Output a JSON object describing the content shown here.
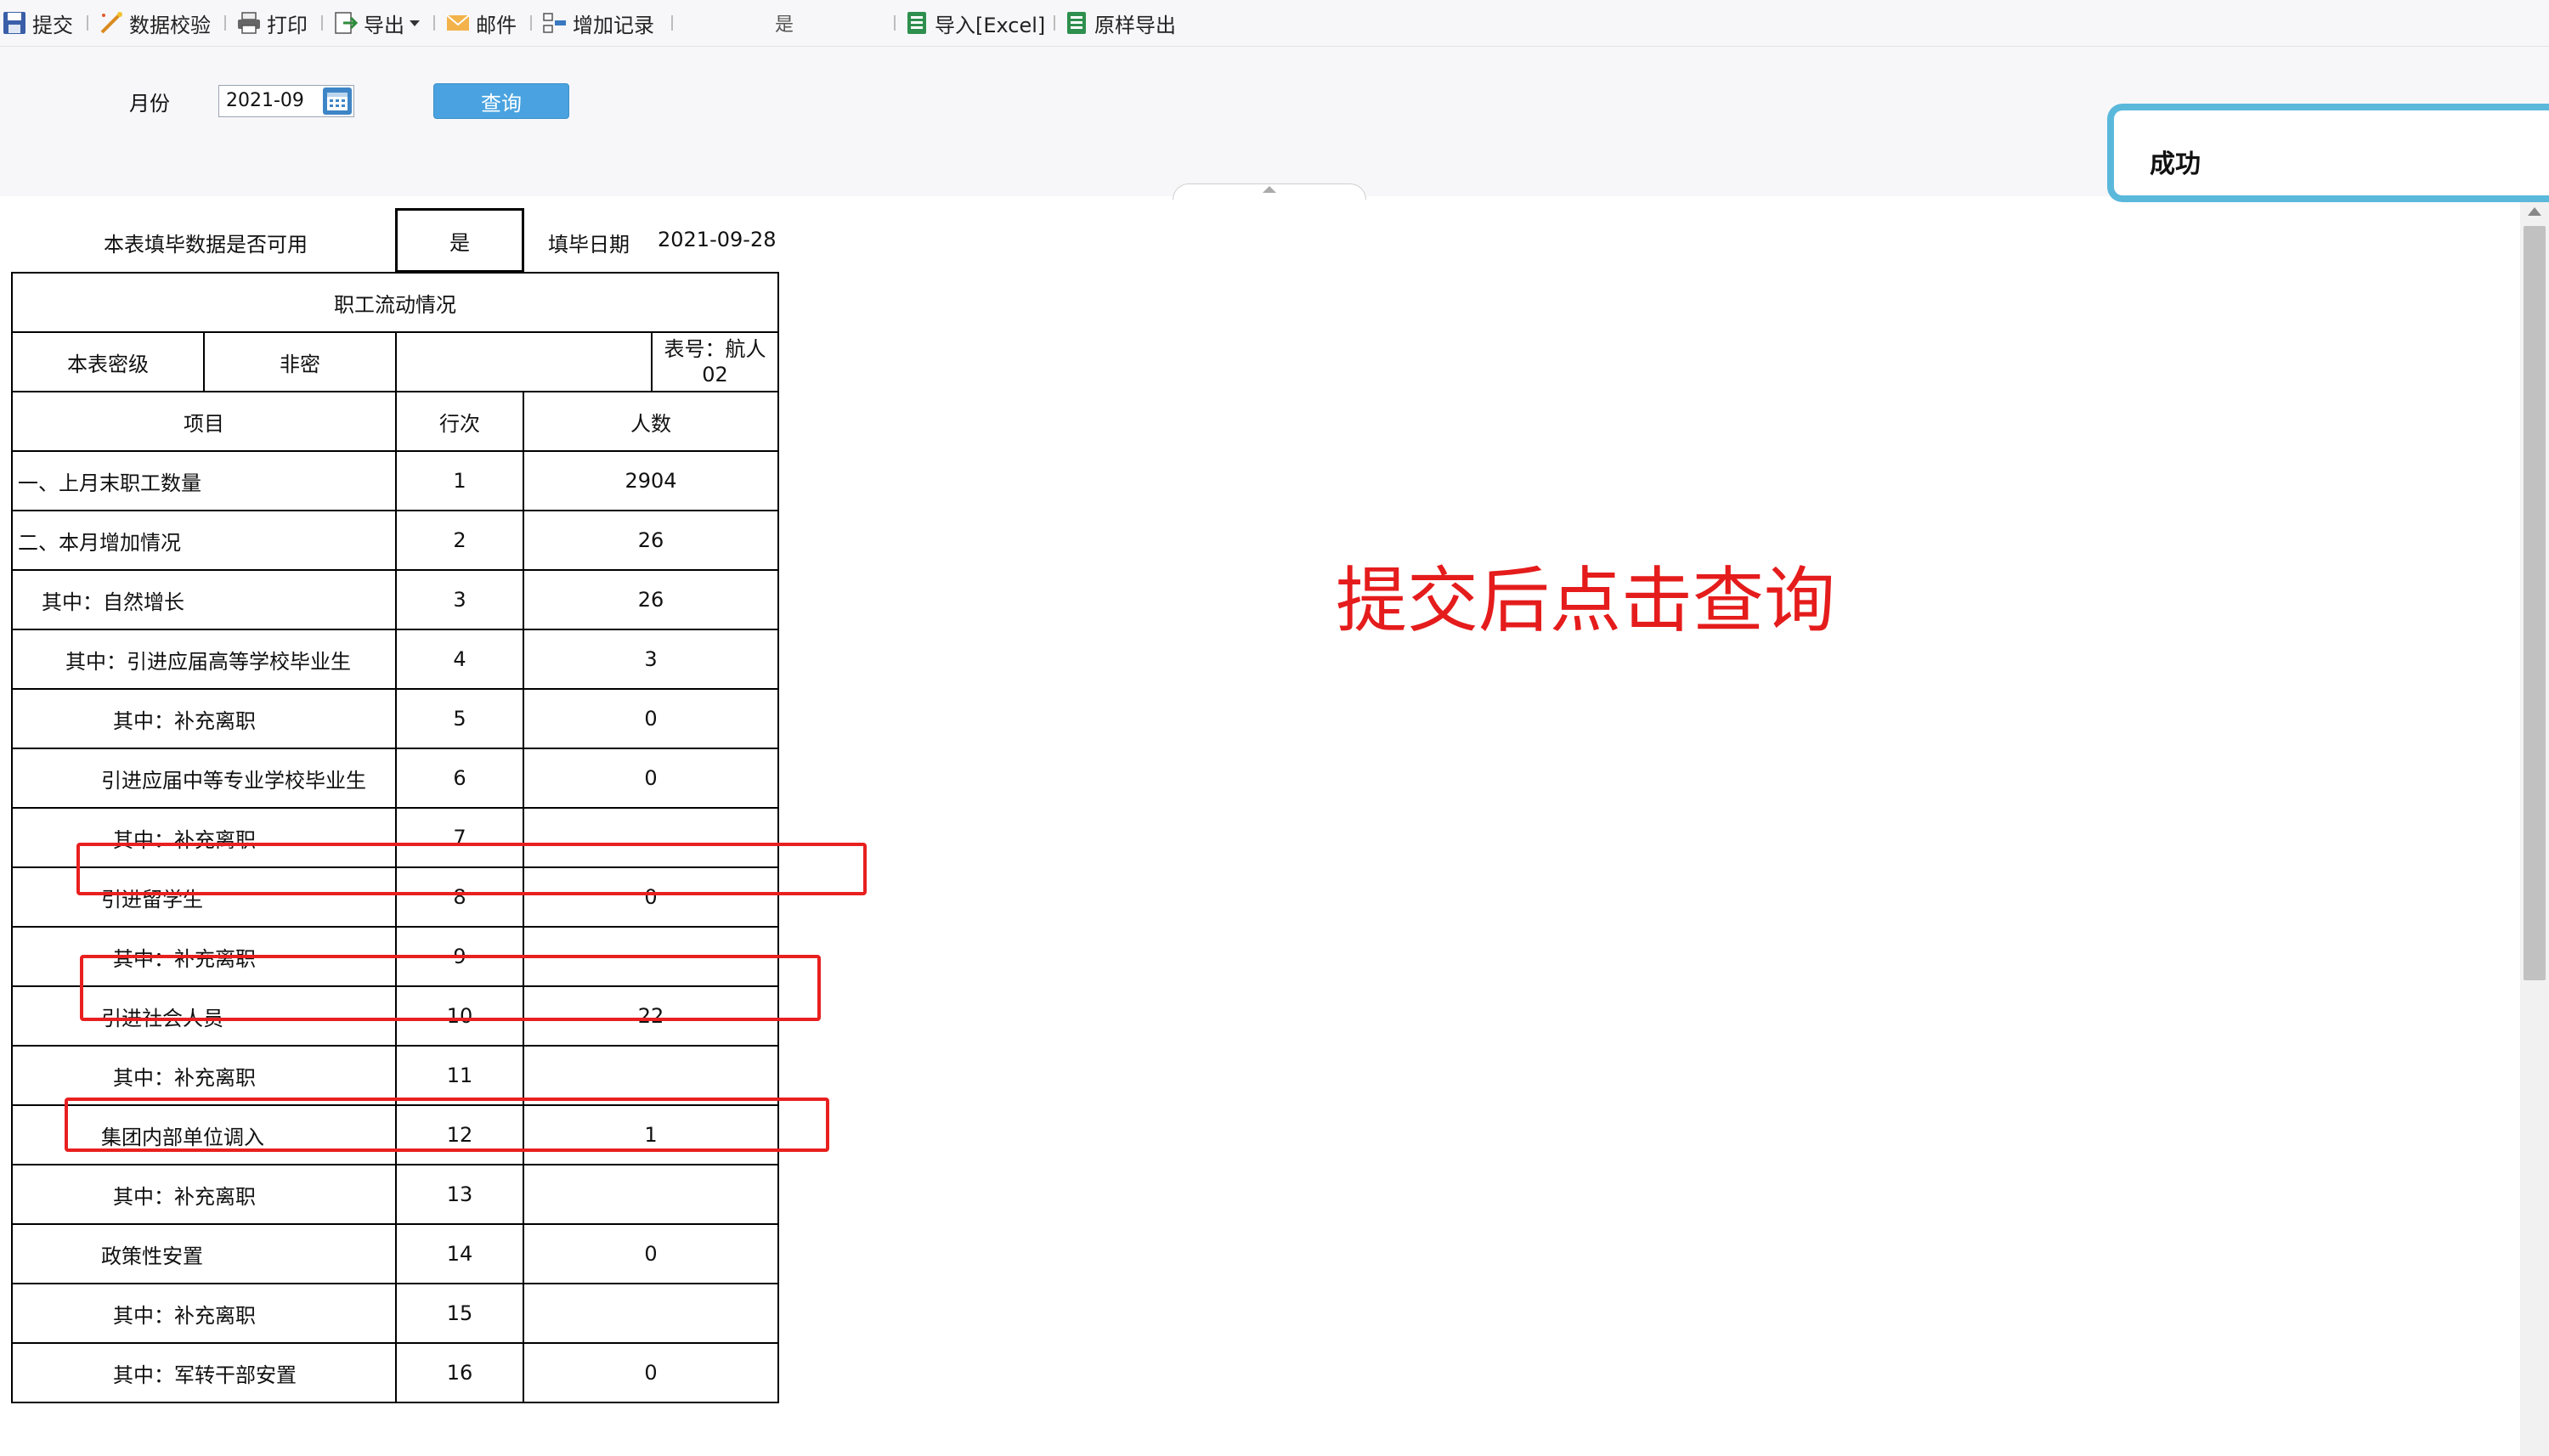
{
  "toolbar": {
    "submit": "提交",
    "validate": "数据校验",
    "print": "打印",
    "export": "导出",
    "mail": "邮件",
    "add_record": "增加记录",
    "status_value": "是",
    "import_excel": "导入[Excel]",
    "raw_export": "原样导出"
  },
  "query": {
    "month_label": "月份",
    "month_value": "2021-09",
    "query_button": "查询"
  },
  "toast": {
    "message": "成功"
  },
  "header": {
    "available_label": "本表填毕数据是否可用",
    "available_value": "是",
    "fill_date_label": "填毕日期",
    "fill_date_value": "2021-09-28"
  },
  "table": {
    "title": "职工流动情况",
    "security_label": "本表密级",
    "security_value": "非密",
    "table_no": "表号：航人02",
    "col_item": "项目",
    "col_row": "行次",
    "col_count": "人数",
    "rows": [
      {
        "item": "一、上月末职工数量",
        "row": "1",
        "count": "2904"
      },
      {
        "item": "二、本月增加情况",
        "row": "2",
        "count": "26"
      },
      {
        "item": "其中：自然增长",
        "row": "3",
        "count": "26"
      },
      {
        "item": "其中：引进应届高等学校毕业生",
        "row": "4",
        "count": "3"
      },
      {
        "item": "其中：补充离职",
        "row": "5",
        "count": "0"
      },
      {
        "item": "引进应届中等专业学校毕业生",
        "row": "6",
        "count": "0"
      },
      {
        "item": "其中：补充离职",
        "row": "7",
        "count": ""
      },
      {
        "item": "引进留学生",
        "row": "8",
        "count": "0"
      },
      {
        "item": "其中：补充离职",
        "row": "9",
        "count": ""
      },
      {
        "item": "引进社会人员",
        "row": "10",
        "count": "22"
      },
      {
        "item": "其中：补充离职",
        "row": "11",
        "count": ""
      },
      {
        "item": "集团内部单位调入",
        "row": "12",
        "count": "1"
      },
      {
        "item": "其中：补充离职",
        "row": "13",
        "count": ""
      },
      {
        "item": "政策性安置",
        "row": "14",
        "count": "0"
      },
      {
        "item": "其中：补充离职",
        "row": "15",
        "count": ""
      },
      {
        "item": "其中：军转干部安置",
        "row": "16",
        "count": "0"
      }
    ]
  },
  "annotation": {
    "text": "提交后点击查询"
  },
  "colors": {
    "toast_border": "#5ab8db",
    "query_button": "#4aa3e0",
    "annotation_red": "#e8201f"
  }
}
